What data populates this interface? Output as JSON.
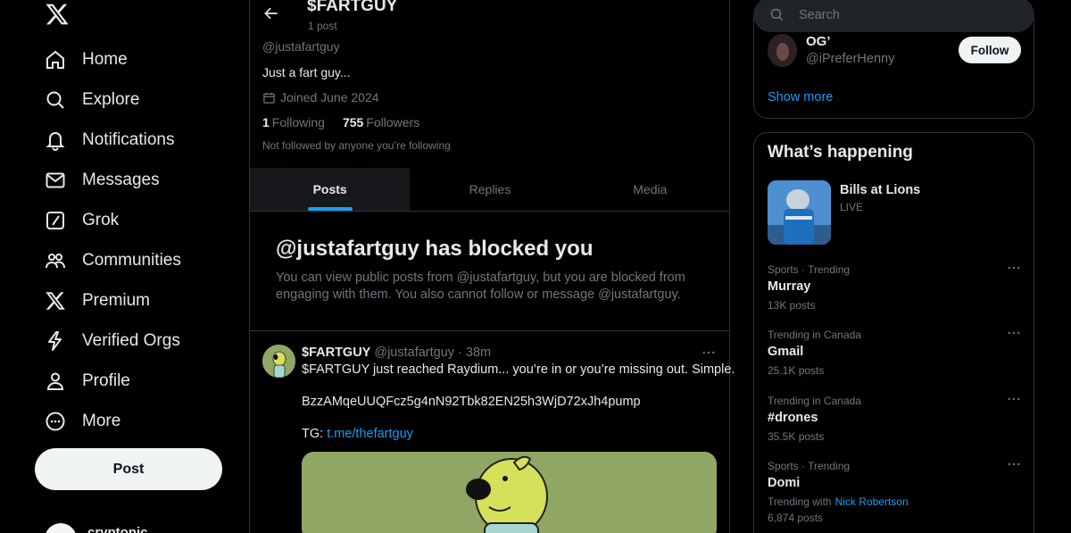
{
  "nav": {
    "items": [
      {
        "label": "Home",
        "icon": "home-icon"
      },
      {
        "label": "Explore",
        "icon": "search-icon"
      },
      {
        "label": "Notifications",
        "icon": "bell-icon"
      },
      {
        "label": "Messages",
        "icon": "mail-icon"
      },
      {
        "label": "Grok",
        "icon": "grok-icon"
      },
      {
        "label": "Communities",
        "icon": "communities-icon"
      },
      {
        "label": "Premium",
        "icon": "x-logo-icon"
      },
      {
        "label": "Verified Orgs",
        "icon": "lightning-icon"
      },
      {
        "label": "Profile",
        "icon": "person-icon"
      },
      {
        "label": "More",
        "icon": "more-circle-icon"
      }
    ],
    "post_label": "Post",
    "account_name": "cryptonic"
  },
  "profile": {
    "display_name": "$FARTGUY",
    "post_count": "1 post",
    "handle": "@justafartguy",
    "bio": "Just a fart guy...",
    "joined": "Joined June 2024",
    "following_count": "1",
    "following_label": "Following",
    "followers_count": "755",
    "followers_label": "Followers",
    "not_followed": "Not followed by anyone you’re following"
  },
  "tabs": [
    "Posts",
    "Replies",
    "Media"
  ],
  "blocked": {
    "title": "@justafartguy has blocked you",
    "body": "You can view public posts from @justafartguy, but you are blocked from engaging with them. You also cannot follow or message @justafartguy."
  },
  "tweet": {
    "name": "$FARTGUY",
    "handle": "@justafartguy",
    "time": "· 38m",
    "line1": "$FARTGUY just reached Raydium... you’re in or you’re missing out. Simple.",
    "line2": "BzzAMqeUUQFcz5g4nN92Tbk82EN25h3WjD72xJh4pump",
    "tg_label": "TG:",
    "tg_link": "t.me/thefartguy"
  },
  "search": {
    "placeholder": "Search"
  },
  "who_to_follow": {
    "name": "OG’",
    "handle": "@iPreferHenny",
    "follow_label": "Follow",
    "show_more": "Show more"
  },
  "whats_happening": {
    "title": "What’s happening",
    "live": {
      "title": "Bills at Lions",
      "status": "LIVE"
    },
    "trends": [
      {
        "context": "Sports · Trending",
        "title": "Murray",
        "count": "13K posts"
      },
      {
        "context": "Trending in Canada",
        "title": "Gmail",
        "count": "25.1K posts"
      },
      {
        "context": "Trending in Canada",
        "title": "#drones",
        "count": "35.5K posts"
      },
      {
        "context": "Sports · Trending",
        "title": "Domi",
        "with_label": "Trending with",
        "with_link": "Nick Robertson",
        "count": "6,874 posts"
      }
    ]
  },
  "colors": {
    "accent": "#1d9bf0",
    "background": "#000000",
    "muted": "#71767b",
    "text": "#e7e9ea"
  }
}
